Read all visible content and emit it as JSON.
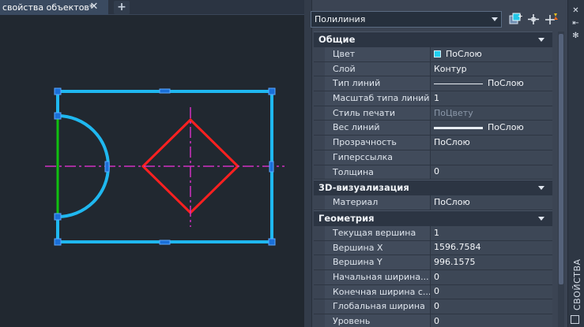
{
  "document_tab": {
    "label": "свойства объектов*",
    "close_glyph": "✕",
    "new_tab_glyph": "+"
  },
  "palette": {
    "vertical_title": "СВОЙСТВА",
    "object_type": "Полилиния",
    "toolbar_icons": [
      "toggle-pickadd-icon",
      "select-objects-icon",
      "quick-select-icon"
    ],
    "strip_icons": [
      "close-icon",
      "auto-hide-icon",
      "palette-settings-icon"
    ],
    "sections": [
      {
        "title": "Общие",
        "rows": [
          {
            "name": "Цвет",
            "value": "ПоСлою"
          },
          {
            "name": "Слой",
            "value": "Контур"
          },
          {
            "name": "Тип линий",
            "value": "ПоСлою"
          },
          {
            "name": "Масштаб типа линий",
            "value": "1"
          },
          {
            "name": "Стиль печати",
            "value": "ПоЦвету"
          },
          {
            "name": "Вес линий",
            "value": "ПоСлою"
          },
          {
            "name": "Прозрачность",
            "value": "ПоСлою"
          },
          {
            "name": "Гиперссылка",
            "value": ""
          },
          {
            "name": "Толщина",
            "value": "0"
          }
        ]
      },
      {
        "title": "3D-визуализация",
        "rows": [
          {
            "name": "Материал",
            "value": "ПоСлою"
          }
        ]
      },
      {
        "title": "Геометрия",
        "rows": [
          {
            "name": "Текущая вершина",
            "value": "1"
          },
          {
            "name": "Вершина X",
            "value": "1596.7584"
          },
          {
            "name": "Вершина Y",
            "value": "996.1575"
          },
          {
            "name": "Начальная  ширина...",
            "value": "0"
          },
          {
            "name": "Конечная ширина с...",
            "value": "0"
          },
          {
            "name": "Глобальная ширина",
            "value": "0"
          },
          {
            "name": "Уровень",
            "value": "0"
          }
        ]
      }
    ]
  },
  "colors": {
    "selected_polyline": "#1fb8f0",
    "diamond": "#ff2020",
    "centerline": "#d030c0",
    "vertical_edge": "#10c010",
    "grips": "#1a6fd8"
  }
}
